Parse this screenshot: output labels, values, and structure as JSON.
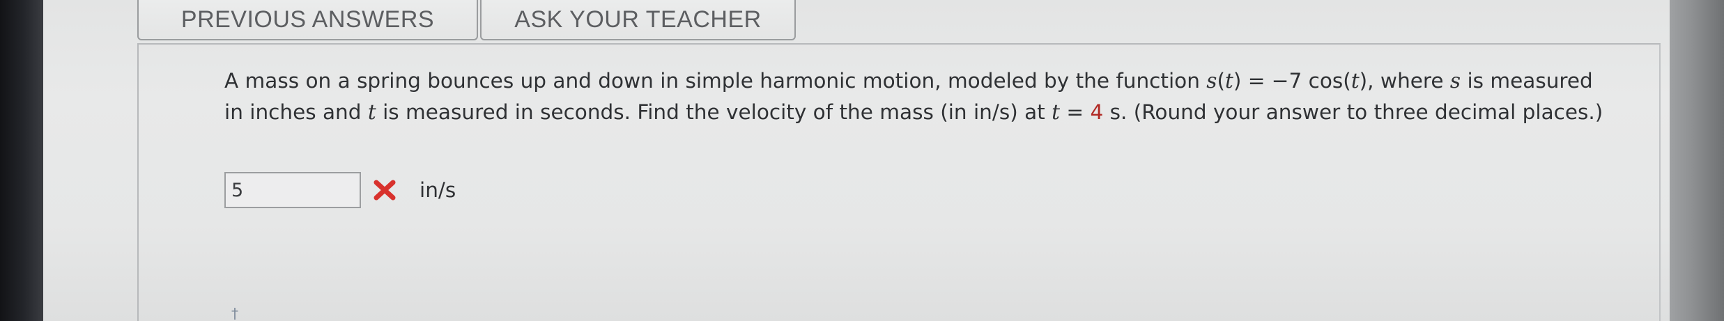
{
  "buttons": {
    "previous_answers": "PREVIOUS ANSWERS",
    "ask_your_teacher": "ASK YOUR TEACHER"
  },
  "question": {
    "part1": "A mass on a spring bounces up and down in simple harmonic motion, modeled by the function ",
    "func_s": "s",
    "paren_open": "(",
    "func_t": "t",
    "paren_close": ")",
    "eq_value": " = −7 cos(",
    "cos_t": "t",
    "cos_close": "), where ",
    "var_s": "s",
    "part2": " is measured in inches and ",
    "var_t": "t",
    "part3": " is measured in seconds. Find the velocity of the mass (in in/s) at ",
    "at_t": "t",
    "equals": " = ",
    "t_value": "4",
    "part4": " s. (Round your answer to three decimal places.)"
  },
  "answer": {
    "value": "5",
    "status": "incorrect",
    "unit": "in/s"
  },
  "colors": {
    "error_red": "#d8322d",
    "given_value_red": "#b12a25"
  },
  "icons": {
    "status": "incorrect-x-icon"
  }
}
